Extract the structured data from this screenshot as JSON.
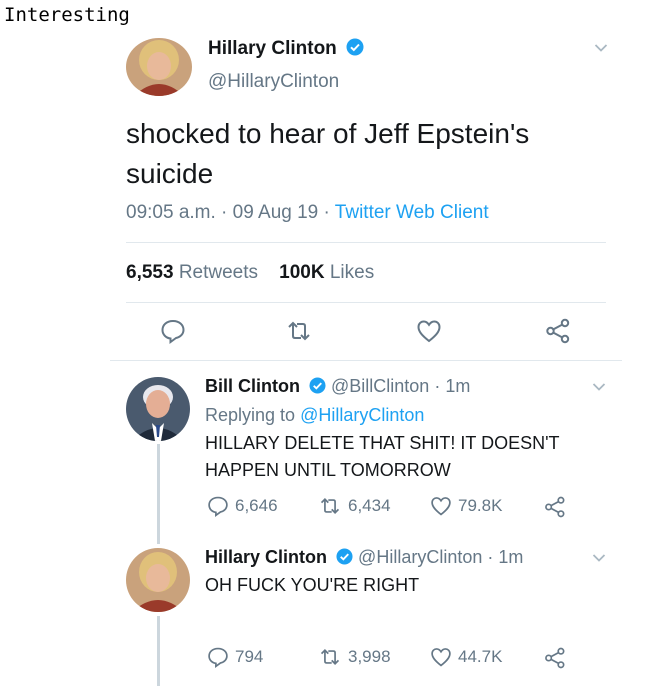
{
  "caption": "Interesting",
  "main_tweet": {
    "name": "Hillary Clinton",
    "handle": "@HillaryClinton",
    "text_line1": "shocked to hear of Jeff Epstein's",
    "text_line2": "suicide",
    "time_date": "09:05 a.m. · 09 Aug 19 ·",
    "source": "Twitter Web Client",
    "retweets_count": "6,553",
    "retweets_label": "Retweets",
    "likes_count": "100K",
    "likes_label": "Likes"
  },
  "replies": [
    {
      "name": "Bill Clinton",
      "handle": "@BillClinton · 1m",
      "replying_to_label": "Replying to",
      "replying_to_handle": "@HillaryClinton",
      "text_line1": "HILLARY DELETE THAT SHIT! IT DOESN'T",
      "text_line2": "HAPPEN UNTIL TOMORROW",
      "reply_count": "6,646",
      "retweet_count": "6,434",
      "like_count": "79.8K"
    },
    {
      "name": "Hillary Clinton",
      "handle": "@HillaryClinton · 1m",
      "text_line1": "OH FUCK YOU'RE RIGHT",
      "reply_count": "794",
      "retweet_count": "3,998",
      "like_count": "44.7K"
    }
  ],
  "colors": {
    "accent": "#1da1f2",
    "secondary_text": "#657786",
    "divider": "#e1e8ed",
    "thread_line": "#ccd6dd"
  },
  "icons": [
    "verified-badge-icon",
    "chevron-down-icon",
    "reply-icon",
    "retweet-icon",
    "like-icon",
    "share-icon"
  ]
}
